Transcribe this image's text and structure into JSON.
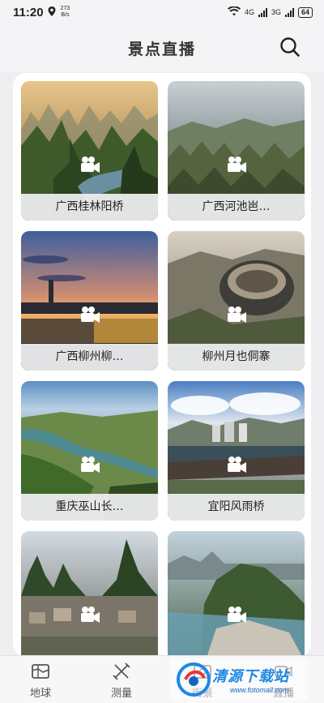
{
  "status_bar": {
    "time": "11:20",
    "speed_value": "273",
    "speed_unit": "B/s",
    "network_4g": "4G",
    "network_3g": "3G",
    "battery": "64"
  },
  "header": {
    "title": "景点直播",
    "search_icon": "search-icon"
  },
  "cards": [
    {
      "label": "广西桂林阳桥",
      "icon": "video-camera-icon"
    },
    {
      "label": "广西河池岜…",
      "icon": "video-camera-icon"
    },
    {
      "label": "广西柳州柳…",
      "icon": "video-camera-icon"
    },
    {
      "label": "柳州月也侗寨",
      "icon": "video-camera-icon"
    },
    {
      "label": "重庆巫山长…",
      "icon": "video-camera-icon"
    },
    {
      "label": "宜阳风雨桥",
      "icon": "video-camera-icon"
    },
    {
      "label": "",
      "icon": "video-camera-icon"
    },
    {
      "label": "",
      "icon": "video-camera-icon"
    }
  ],
  "bottom_nav": {
    "items": [
      {
        "label": "地球",
        "icon": "map-icon"
      },
      {
        "label": "测量",
        "icon": "ruler-pencil-icon"
      },
      {
        "label": "街景",
        "icon": "street-view-icon"
      },
      {
        "label": "直播",
        "icon": "live-icon"
      }
    ]
  },
  "watermark": {
    "text": "清源下载站",
    "url": "www.fotomall.com"
  }
}
